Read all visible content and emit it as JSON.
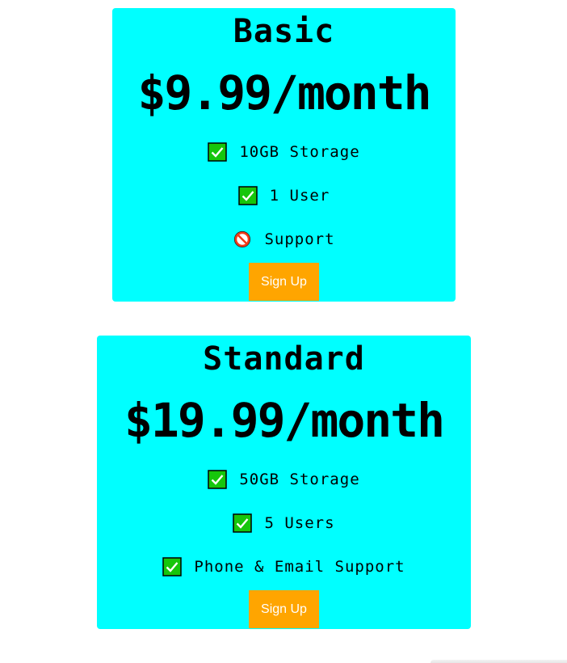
{
  "plans": [
    {
      "name": "Basic",
      "price": "$9.99/month",
      "features": [
        {
          "icon": "check-icon",
          "text": "10GB Storage"
        },
        {
          "icon": "check-icon",
          "text": "1 User"
        },
        {
          "icon": "prohibited-icon",
          "text": "Support"
        }
      ],
      "button_label": "Sign Up"
    },
    {
      "name": "Standard",
      "price": "$19.99/month",
      "features": [
        {
          "icon": "check-icon",
          "text": "50GB Storage"
        },
        {
          "icon": "check-icon",
          "text": "5 Users"
        },
        {
          "icon": "check-icon",
          "text": "Phone & Email Support"
        }
      ],
      "button_label": "Sign Up"
    }
  ],
  "colors": {
    "card_background": "#00ffff",
    "button_background": "#ffa500",
    "button_text": "#ffffff",
    "check_green": "#16c60c"
  }
}
